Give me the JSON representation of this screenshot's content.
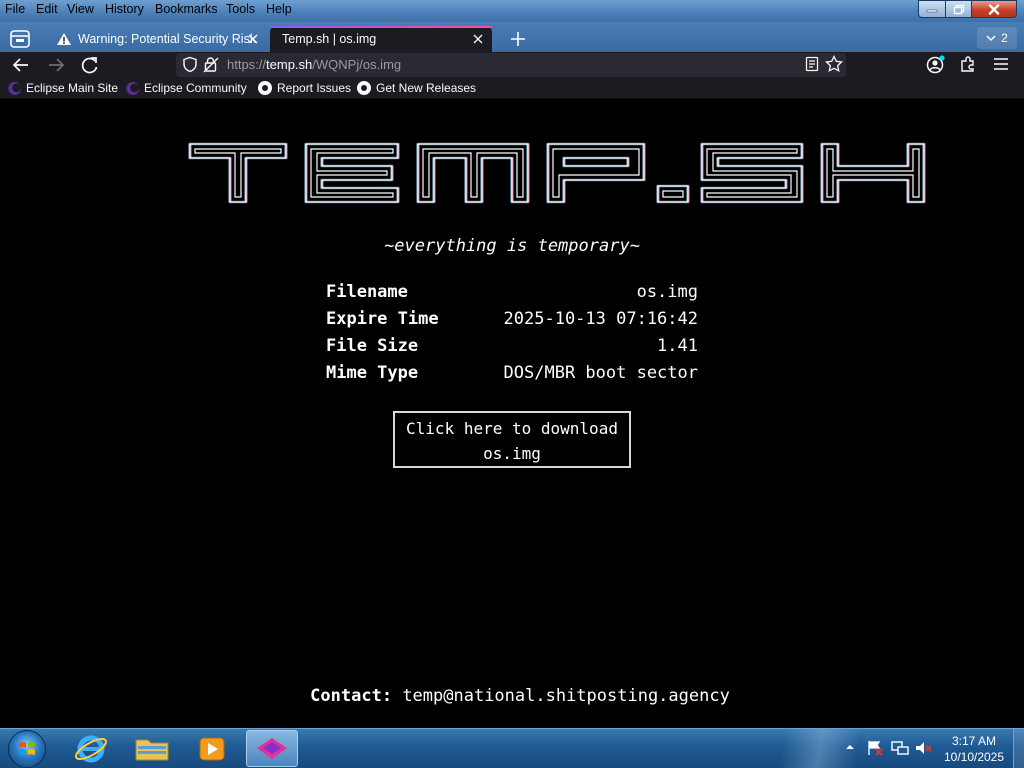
{
  "browser": {
    "menu": [
      "File",
      "Edit",
      "View",
      "History",
      "Bookmarks",
      "Tools",
      "Help"
    ],
    "tabs": [
      {
        "label": "Warning: Potential Security Risk",
        "icon": "warning-icon"
      },
      {
        "label": "Temp.sh | os.img",
        "active": true
      }
    ],
    "tab_count": "2",
    "url": {
      "prefix": "https://",
      "domain": "temp.sh",
      "path": "/WQNPj/os.img"
    },
    "bookmarks": [
      {
        "label": "Eclipse Main Site",
        "icon": "eclipse-icon"
      },
      {
        "label": "Eclipse Community",
        "icon": "eclipse-icon"
      },
      {
        "label": "Report Issues",
        "icon": "github-icon"
      },
      {
        "label": "Get New Releases",
        "icon": "github-icon"
      }
    ]
  },
  "page": {
    "logo_text": "TEMP.SH",
    "tagline": "~everything is temporary~",
    "info": [
      {
        "key": "Filename",
        "value": "os.img"
      },
      {
        "key": "Expire Time",
        "value": "2025-10-13 07:16:42"
      },
      {
        "key": "File Size",
        "value": "1.41"
      },
      {
        "key": "Mime Type",
        "value": "DOS/MBR boot sector"
      }
    ],
    "download": {
      "line1": "Click here to download",
      "line2": "os.img"
    },
    "contact": {
      "label": "Contact:",
      "email": "temp@national.shitposting.agency"
    }
  },
  "taskbar": {
    "time": "3:17 AM",
    "date": "10/10/2025"
  },
  "colors": {
    "page_bg": "#000000",
    "text": "#ffffff",
    "tab_active_bg": "#1c1b22",
    "accent": "#9059ff"
  }
}
